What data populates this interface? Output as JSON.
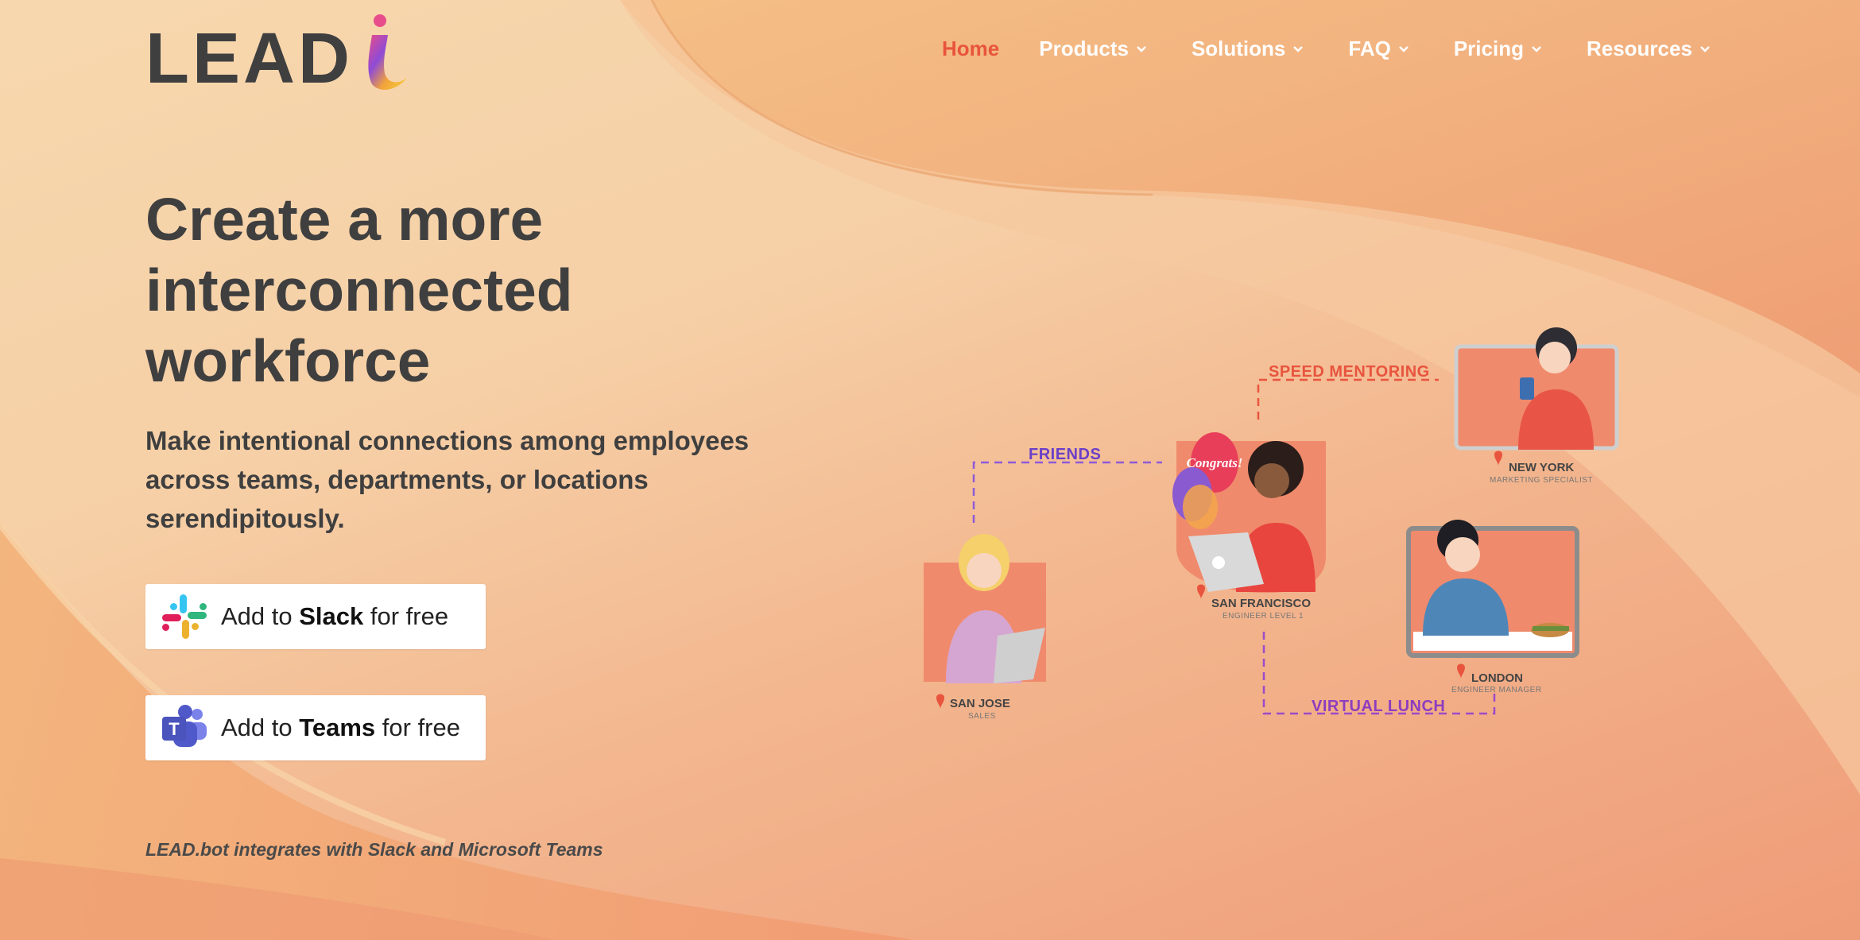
{
  "brand": {
    "logo_text": "LEAD",
    "colors": {
      "text": "#3f3f3f",
      "accent": "#e8543e",
      "friends": "#6a3fc8",
      "mentoring": "#e8543e",
      "lunch": "#8e3dbf"
    }
  },
  "nav": {
    "items": [
      {
        "label": "Home",
        "active": true,
        "has_dropdown": false
      },
      {
        "label": "Products",
        "active": false,
        "has_dropdown": true
      },
      {
        "label": "Solutions",
        "active": false,
        "has_dropdown": true
      },
      {
        "label": "FAQ",
        "active": false,
        "has_dropdown": true
      },
      {
        "label": "Pricing",
        "active": false,
        "has_dropdown": true
      },
      {
        "label": "Resources",
        "active": false,
        "has_dropdown": true
      }
    ]
  },
  "hero": {
    "title_lines": [
      "Create a more",
      "interconnected",
      "workforce"
    ],
    "subtitle_lines": [
      "Make intentional connections among employees",
      "across teams, departments, or locations",
      "serendipitously."
    ]
  },
  "buttons": {
    "slack": {
      "prefix": "Add to ",
      "product": "Slack",
      "suffix": " for free",
      "icon": "slack-icon"
    },
    "teams": {
      "prefix": "Add to ",
      "product": "Teams",
      "suffix": " for free",
      "icon": "teams-icon"
    }
  },
  "footer_note": "LEAD.bot integrates with Slack and Microsoft Teams",
  "illustration": {
    "connections": {
      "friends": "FRIENDS",
      "speed_mentoring": "SPEED MENTORING",
      "virtual_lunch": "VIRTUAL LUNCH"
    },
    "people": [
      {
        "id": "san-jose",
        "location": "SAN JOSE",
        "role": "SALES"
      },
      {
        "id": "san-francisco",
        "location": "SAN FRANCISCO",
        "role": "ENGINEER LEVEL 1",
        "balloon_text": "Congrats!"
      },
      {
        "id": "new-york",
        "location": "NEW YORK",
        "role": "MARKETING SPECIALIST"
      },
      {
        "id": "london",
        "location": "LONDON",
        "role": "ENGINEER MANAGER"
      }
    ]
  }
}
